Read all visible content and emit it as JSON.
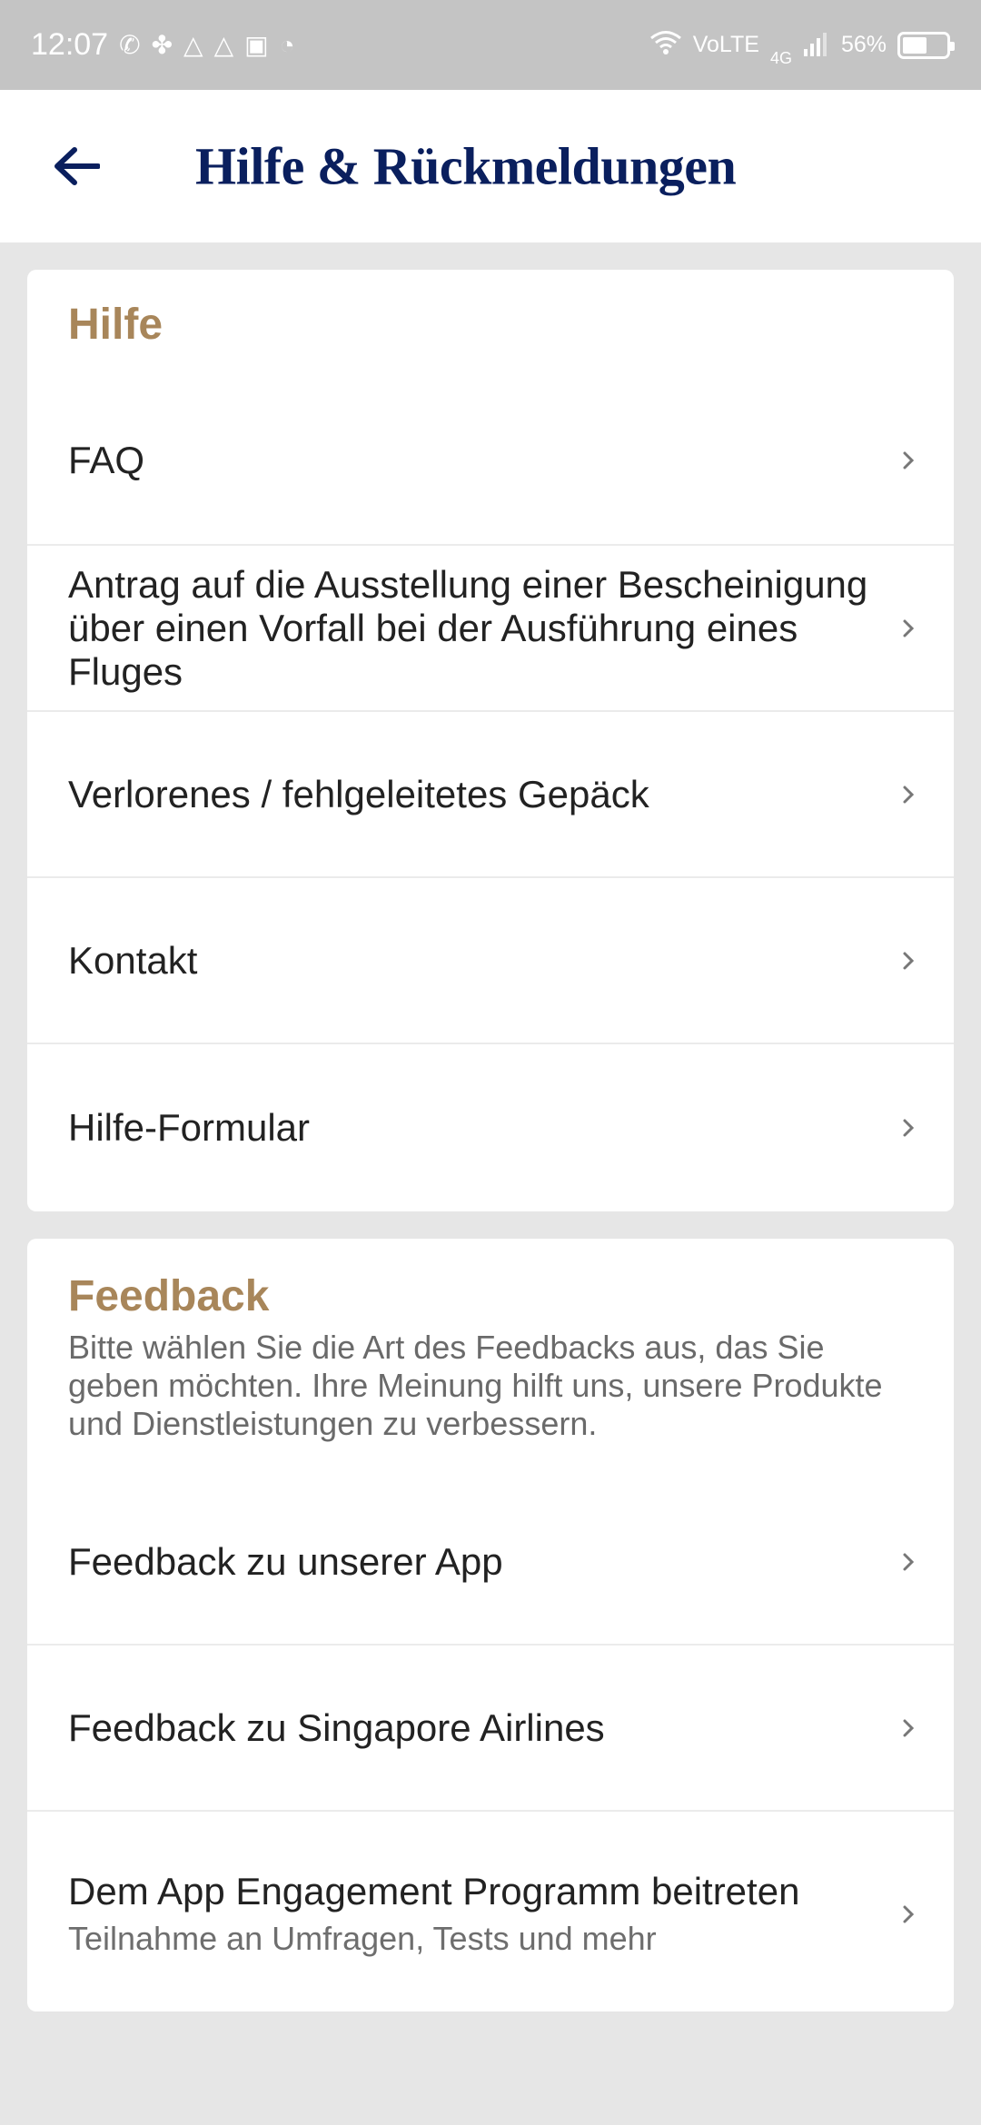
{
  "status_bar": {
    "time": "12:07",
    "network": "VoLTE",
    "network_gen": "4G",
    "battery_percent": "56%",
    "battery_level": 0.56
  },
  "header": {
    "title": "Hilfe & Rückmeldungen",
    "title_color": "#0a1f5e"
  },
  "help_section": {
    "title": "Hilfe",
    "items": [
      {
        "label": "FAQ"
      },
      {
        "label": "Antrag auf die Ausstellung einer Bescheinigung über einen Vorfall bei der Ausführung eines Fluges"
      },
      {
        "label": "Verlorenes / fehlgeleitetes Gepäck"
      },
      {
        "label": "Kontakt"
      },
      {
        "label": "Hilfe-Formular"
      }
    ]
  },
  "feedback_section": {
    "title": "Feedback",
    "description": "Bitte wählen Sie die Art des Feedbacks aus, das Sie geben möchten. Ihre Meinung hilft uns, unsere Produkte und Dienstleistungen zu verbessern.",
    "items": [
      {
        "label": "Feedback zu unserer App"
      },
      {
        "label": "Feedback zu Singapore Airlines"
      },
      {
        "label": "Dem App Engagement Programm beitreten",
        "sublabel": "Teilnahme an Umfragen, Tests und mehr"
      }
    ]
  },
  "colors": {
    "accent_gold": "#a8865a",
    "background": "#e6e6e6"
  }
}
